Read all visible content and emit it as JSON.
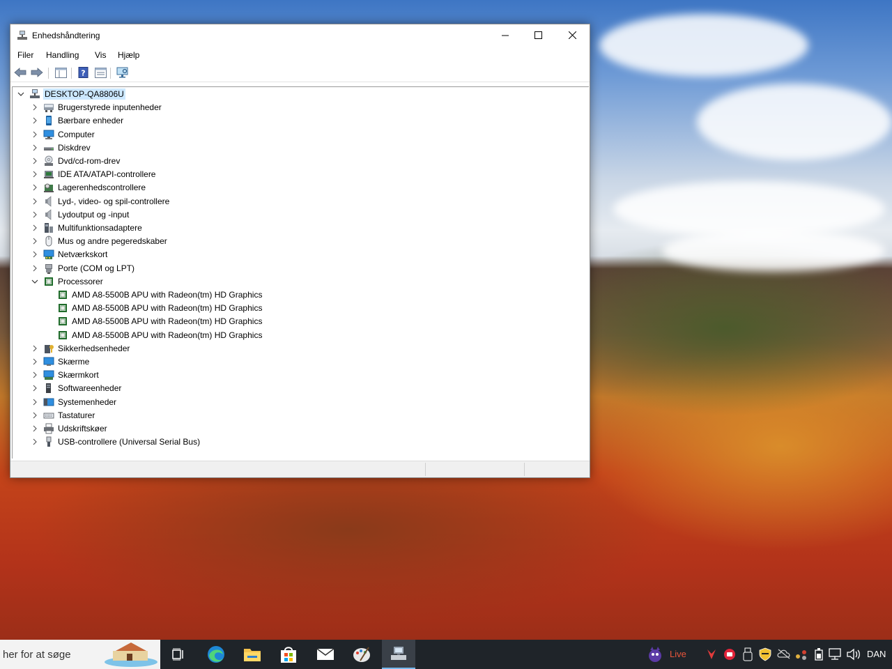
{
  "window": {
    "title": "Enhedshåndtering",
    "menu": [
      "Filer",
      "Handling",
      "Vis",
      "Hjælp"
    ]
  },
  "tree": {
    "root": "DESKTOP-QA8806U",
    "categories": [
      {
        "label": "Brugerstyrede inputenheder",
        "icon": "hid-icon"
      },
      {
        "label": "Bærbare enheder",
        "icon": "portable-device-icon"
      },
      {
        "label": "Computer",
        "icon": "computer-monitor-icon"
      },
      {
        "label": "Diskdrev",
        "icon": "disk-drive-icon"
      },
      {
        "label": "Dvd/cd-rom-drev",
        "icon": "dvd-drive-icon"
      },
      {
        "label": "IDE ATA/ATAPI-controllere",
        "icon": "ide-controller-icon"
      },
      {
        "label": "Lagerenhedscontrollere",
        "icon": "storage-controller-icon"
      },
      {
        "label": "Lyd-, video- og spil-controllere",
        "icon": "speaker-icon"
      },
      {
        "label": "Lydoutput og -input",
        "icon": "speaker-icon"
      },
      {
        "label": "Multifunktionsadaptere",
        "icon": "multifunction-icon"
      },
      {
        "label": "Mus og andre pegeredskaber",
        "icon": "mouse-icon"
      },
      {
        "label": "Netværkskort",
        "icon": "network-adapter-icon"
      },
      {
        "label": "Porte (COM og LPT)",
        "icon": "port-icon"
      },
      {
        "label": "Processorer",
        "icon": "processor-icon",
        "expanded": true,
        "children": [
          "AMD A8-5500B APU with Radeon(tm) HD Graphics",
          "AMD A8-5500B APU with Radeon(tm) HD Graphics",
          "AMD A8-5500B APU with Radeon(tm) HD Graphics",
          "AMD A8-5500B APU with Radeon(tm) HD Graphics"
        ]
      },
      {
        "label": "Sikkerhedsenheder",
        "icon": "security-device-icon"
      },
      {
        "label": "Skærme",
        "icon": "monitor-icon"
      },
      {
        "label": "Skærmkort",
        "icon": "display-adapter-icon"
      },
      {
        "label": "Softwareenheder",
        "icon": "software-device-icon"
      },
      {
        "label": "Systemenheder",
        "icon": "system-device-icon"
      },
      {
        "label": "Tastaturer",
        "icon": "keyboard-icon"
      },
      {
        "label": "Udskriftskøer",
        "icon": "printer-icon"
      },
      {
        "label": "USB-controllere (Universal Serial Bus)",
        "icon": "usb-icon"
      }
    ]
  },
  "taskbar": {
    "search_placeholder": "her for at søge",
    "live_label": "Live",
    "language": "DAN"
  },
  "colors": {
    "selection": "#cce8ff",
    "taskbar": "#1f2429",
    "live_text": "#e8553b"
  }
}
